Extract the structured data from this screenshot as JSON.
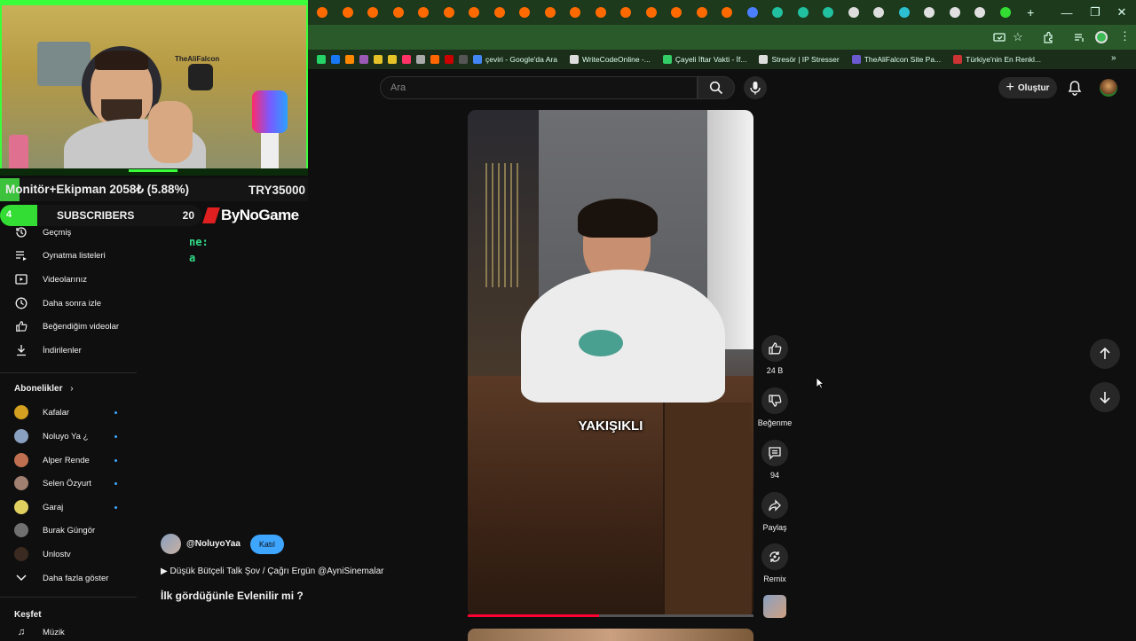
{
  "browser": {
    "tab_favicons": [
      "#ff6a00",
      "#ff6a00",
      "#ff6a00",
      "#ff6a00",
      "#ff6a00",
      "#ff6a00",
      "#ff6a00",
      "#ff6a00",
      "#ff6a00",
      "#ff6a00",
      "#ff6a00",
      "#ff6a00",
      "#ff6a00",
      "#ff6a00",
      "#ff6a00",
      "#ff6a00",
      "#ff6a00",
      "#4a80ff",
      "#21c0a0",
      "#21c0a0",
      "#21c0a0",
      "#dddddd",
      "#dddddd",
      "#2cc0d0",
      "#e0e0e0",
      "#e0e0e0",
      "#e0e0e0",
      "#33dd33"
    ],
    "new_tab": "+",
    "bookmarks": [
      {
        "label": "",
        "color": "#25d366"
      },
      {
        "label": "",
        "color": "#1877f2"
      },
      {
        "label": "",
        "color": "#ff8800"
      },
      {
        "label": "",
        "color": "#9b59b6"
      },
      {
        "label": "",
        "color": "#e6c229"
      },
      {
        "label": "",
        "color": "#e6c229"
      },
      {
        "label": "",
        "color": "#ff3366"
      },
      {
        "label": "",
        "color": "#aaaaaa"
      },
      {
        "label": "",
        "color": "#ff6600"
      },
      {
        "label": "",
        "color": "#cc0000"
      },
      {
        "label": "",
        "color": "#555555"
      },
      {
        "label": "çeviri - Google'da Ara",
        "color": "#4285f4"
      },
      {
        "label": "WriteCodeOnline -...",
        "color": "#dddddd"
      },
      {
        "label": "Çayeli İftar Vakti - İf...",
        "color": "#33cc66"
      },
      {
        "label": "Stresör | IP Stresser",
        "color": "#dddddd"
      },
      {
        "label": "TheAliFalcon Site Pa...",
        "color": "#6a5acd"
      },
      {
        "label": "Türkiye'nin En Renkl...",
        "color": "#cc3333"
      }
    ]
  },
  "overlay": {
    "banner_text": "TheAliFalcon",
    "goal_label": "Monitör+Ekipman 2058₺ (5.88%)",
    "goal_target": "TRY35000",
    "subs_left": "4",
    "subs_label": "SUBSCRIBERS",
    "subs_right": "20",
    "brand": "ByNoGame",
    "chat_1": "ne:",
    "chat_2": "a"
  },
  "header": {
    "search_placeholder": "Ara",
    "create_label": "Oluştur"
  },
  "sidebar": {
    "you_items": [
      {
        "label": "Geçmiş",
        "icon": "history-icon"
      },
      {
        "label": "Oynatma listeleri",
        "icon": "playlist-icon"
      },
      {
        "label": "Videolarınız",
        "icon": "your-videos-icon"
      },
      {
        "label": "Daha sonra izle",
        "icon": "watch-later-icon"
      },
      {
        "label": "Beğendiğim videolar",
        "icon": "thumbs-up-icon"
      },
      {
        "label": "İndirilenler",
        "icon": "download-icon"
      }
    ],
    "subscriptions_header": "Abonelikler",
    "subscriptions": [
      {
        "label": "Kafalar",
        "color": "#d4a020"
      },
      {
        "label": "Noluyo Ya ¿",
        "color": "#8aa0c0"
      },
      {
        "label": "Alper Rende",
        "color": "#c07050"
      },
      {
        "label": "Selen Özyurt",
        "color": "#a08070"
      },
      {
        "label": "Garaj",
        "color": "#e0d060"
      },
      {
        "label": "Burak Güngör",
        "color": "#707070"
      },
      {
        "label": "Unlostv",
        "color": "#3a2a20"
      }
    ],
    "show_more": "Daha fazla göster",
    "explore_header": "Keşfet",
    "explore_first": "Müzik"
  },
  "short": {
    "caption": "YAKIŞIKLI",
    "likes": "24 B",
    "dislike_label": "Beğenme",
    "comments": "94",
    "share_label": "Paylaş",
    "remix_label": "Remix",
    "channel_handle": "@NoluyoYaa",
    "join_label": "Katıl",
    "music": "▶ Düşük Bütçeli Talk Şov / Çağrı Ergün @AyniSinemalar",
    "title": "İlk gördüğünle Evlenilir mi ?",
    "progress": 0.46
  }
}
